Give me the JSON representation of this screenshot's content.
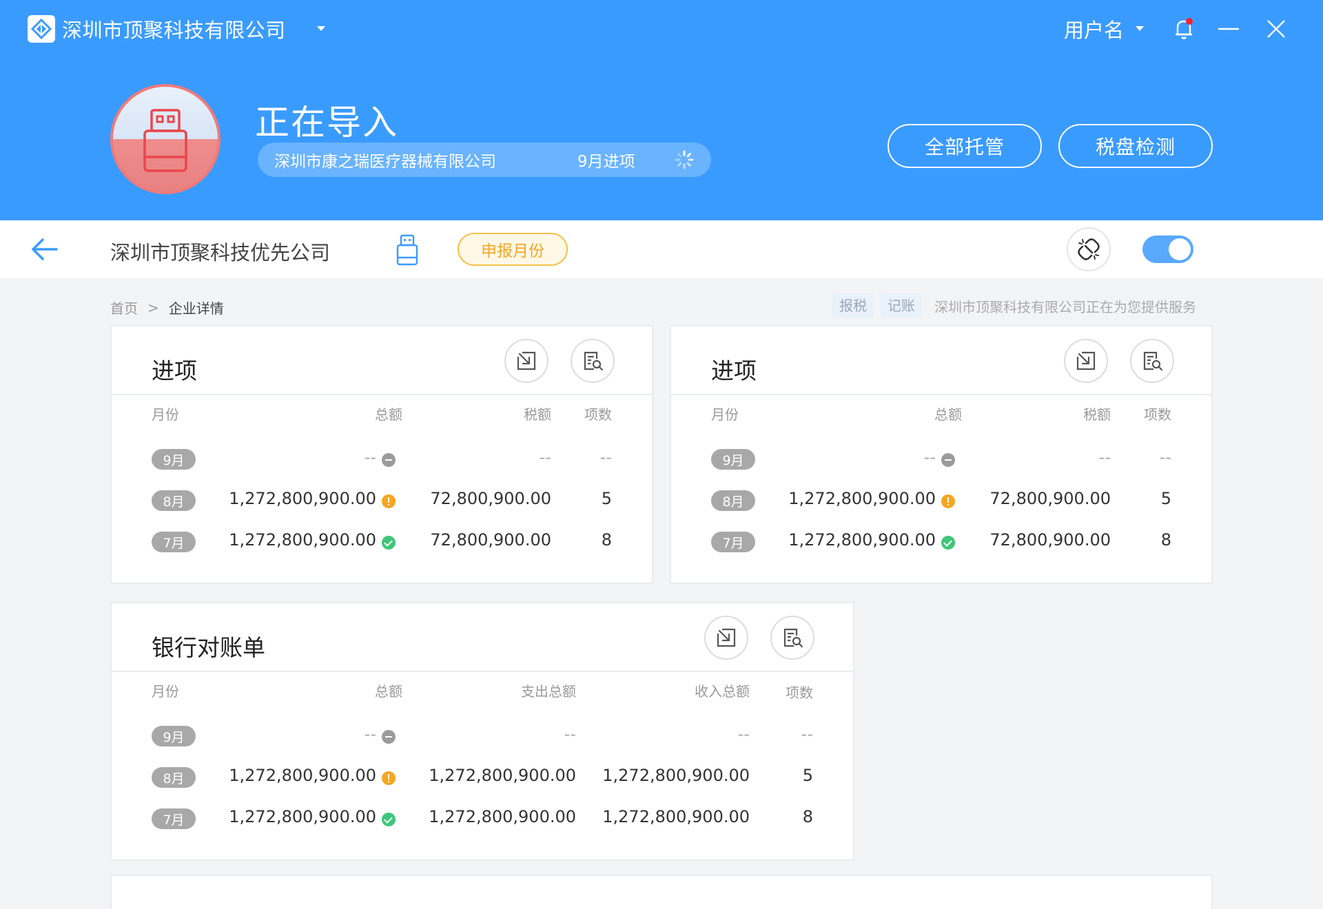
{
  "app": {
    "company_name": "深圳市顶聚科技有限公司",
    "user_name": "用户名"
  },
  "import_status": {
    "title": "正在导入",
    "company": "深圳市康之瑞医疗器械有限公司",
    "month": "9月进项"
  },
  "header_buttons": {
    "full_hosting": "全部托管",
    "tax_disk_check": "税盘检测"
  },
  "subbar": {
    "company": "深圳市顶聚科技优先公司",
    "month_tag": "申报月份"
  },
  "breadcrumb": {
    "home": "首页",
    "separator": ">",
    "current": "企业详情"
  },
  "service": {
    "tags": [
      "报税",
      "记账"
    ],
    "text": "深圳市顶聚科技有限公司正在为您提供服务"
  },
  "panels": [
    {
      "title": "进项",
      "headers": [
        "月份",
        "总额",
        "税额",
        "项数"
      ],
      "rows": [
        {
          "month": "9月",
          "total": "--",
          "status": "gray",
          "tax": "--",
          "count": "--"
        },
        {
          "month": "8月",
          "total": "1,272,800,900.00",
          "status": "orange",
          "tax": "72,800,900.00",
          "count": "5"
        },
        {
          "month": "7月",
          "total": "1,272,800,900.00",
          "status": "green",
          "tax": "72,800,900.00",
          "count": "8"
        }
      ]
    },
    {
      "title": "进项",
      "headers": [
        "月份",
        "总额",
        "税额",
        "项数"
      ],
      "rows": [
        {
          "month": "9月",
          "total": "--",
          "status": "gray",
          "tax": "--",
          "count": "--"
        },
        {
          "month": "8月",
          "total": "1,272,800,900.00",
          "status": "orange",
          "tax": "72,800,900.00",
          "count": "5"
        },
        {
          "month": "7月",
          "total": "1,272,800,900.00",
          "status": "green",
          "tax": "72,800,900.00",
          "count": "8"
        }
      ]
    },
    {
      "title": "银行对账单",
      "headers": [
        "月份",
        "总额",
        "支出总额",
        "收入总额",
        "项数"
      ],
      "rows": [
        {
          "month": "9月",
          "total": "--",
          "status": "gray",
          "expense": "--",
          "income": "--",
          "count": "--"
        },
        {
          "month": "8月",
          "total": "1,272,800,900.00",
          "status": "orange",
          "expense": "1,272,800,900.00",
          "income": "1,272,800,900.00",
          "count": "5"
        },
        {
          "month": "7月",
          "total": "1,272,800,900.00",
          "status": "green",
          "expense": "1,272,800,900.00",
          "income": "1,272,800,900.00",
          "count": "8"
        }
      ]
    }
  ],
  "status_colors": {
    "gray": "#9b9b9b",
    "orange": "#f5a623",
    "green": "#3fc67a"
  },
  "colors": {
    "header_blue": "#3a9bff",
    "notification_dot": "#f5222d",
    "month_tag": "#f5a623"
  },
  "icons": {
    "brand": "diamond-logo-icon",
    "bell": "bell-icon",
    "minimize": "minimize-icon",
    "close": "close-icon",
    "usb": "usb-key-icon",
    "back": "back-arrow-icon",
    "unlink": "unlink-icon",
    "import": "import-icon",
    "search_doc": "document-search-icon"
  }
}
